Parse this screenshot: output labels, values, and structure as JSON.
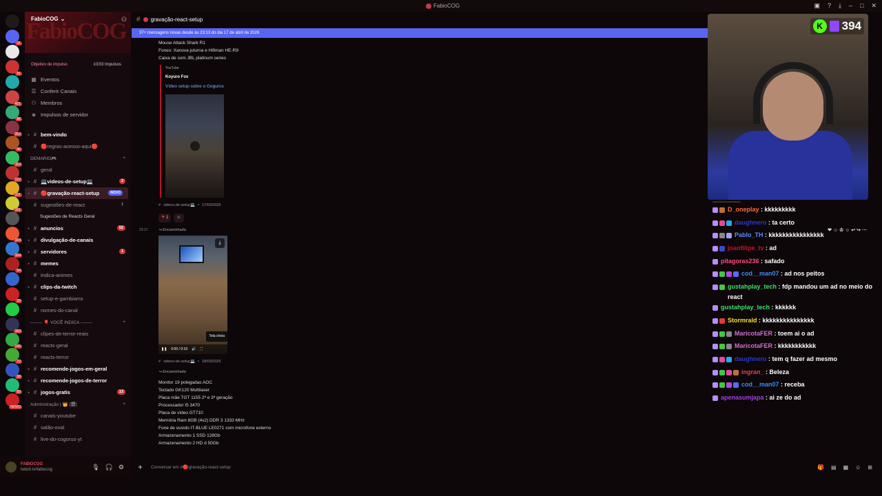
{
  "window": {
    "title": "FabioCOG"
  },
  "servers": [
    {
      "color": "#5865f2",
      "count": "31"
    },
    {
      "color": "#e8e8e8",
      "count": ""
    },
    {
      "color": "#c33",
      "count": "81"
    },
    {
      "color": "#2aa",
      "count": ""
    },
    {
      "color": "#c44",
      "count": "421"
    },
    {
      "color": "#3a7",
      "count": "86"
    },
    {
      "color": "#834",
      "count": "262"
    },
    {
      "color": "#a52",
      "count": "46"
    },
    {
      "color": "#3b6",
      "count": "110"
    },
    {
      "color": "#b33",
      "count": "122"
    },
    {
      "color": "#da2",
      "count": "101"
    },
    {
      "color": "#cc3",
      "count": "101"
    },
    {
      "color": "#555",
      "count": ""
    },
    {
      "color": "#e53",
      "count": "104"
    },
    {
      "color": "#37c",
      "count": "104"
    },
    {
      "color": "#a22",
      "count": "54"
    },
    {
      "color": "#36c",
      "count": ""
    },
    {
      "color": "#c22",
      "count": "15"
    },
    {
      "color": "#2c4",
      "count": ""
    },
    {
      "color": "#335",
      "count": "163"
    },
    {
      "color": "#3a4",
      "count": "145"
    },
    {
      "color": "#4a3",
      "count": "72"
    },
    {
      "color": "#35b",
      "count": "38"
    },
    {
      "color": "#2b7",
      "count": "83"
    },
    {
      "color": "#c22",
      "count": "NOVO"
    }
  ],
  "guild": {
    "name": "FabioCOG",
    "banner": "FabioCOG",
    "boost_label": "Objetivo de impulso",
    "boost_value": "10/33 Impulsos"
  },
  "nav": [
    {
      "label": "Eventos"
    },
    {
      "label": "Conferir Canais"
    },
    {
      "label": "Membros"
    },
    {
      "label": "Impulsos de servidor"
    }
  ],
  "channels": {
    "welcome": [
      {
        "label": "bem-vindo",
        "bold": true
      },
      {
        "label": "🔴regras-acesso-aqui🔴",
        "bold": false
      }
    ],
    "cat_demario": "DEMARIO🎮",
    "demario": [
      {
        "label": "geral",
        "bold": false,
        "badge": ""
      },
      {
        "label": "💻videos-de-setup💻",
        "bold": true,
        "badge": "2"
      },
      {
        "label": "🔴gravação-react-setup",
        "bold": true,
        "badge": "NOVO",
        "active": true
      },
      {
        "label": "sugestões-de-react",
        "bold": false,
        "badge": "1",
        "plain": true
      }
    ],
    "thread": "Sugestões de Reacts Geral",
    "demario2": [
      {
        "label": "anuncios",
        "bold": true,
        "badge": "52"
      },
      {
        "label": "divulgação-de-canais",
        "bold": true,
        "badge": ""
      },
      {
        "label": "servidores",
        "bold": true,
        "badge": "1"
      },
      {
        "label": "memes",
        "bold": true,
        "badge": ""
      },
      {
        "label": "indica-animes",
        "bold": false,
        "badge": ""
      },
      {
        "label": "clips-da-twitch",
        "bold": true,
        "badge": ""
      },
      {
        "label": "setup-e-gambiarra",
        "bold": false,
        "badge": ""
      },
      {
        "label": "nomes-do-canal",
        "bold": false,
        "badge": ""
      }
    ],
    "cat_indica": "-------- 🎈 VOCÊ INDICA --------",
    "indica": [
      {
        "label": "clipes-de-terror-reais",
        "bold": false,
        "badge": ""
      },
      {
        "label": "reacts-geral",
        "bold": false,
        "badge": ""
      },
      {
        "label": "reacts-terror",
        "bold": false,
        "badge": ""
      },
      {
        "label": "recomende-jogos-em-geral",
        "bold": true,
        "badge": ""
      },
      {
        "label": "recomende-jogos-de-terror",
        "bold": true,
        "badge": ""
      },
      {
        "label": "jogos-gratis",
        "bold": true,
        "badge": "13"
      }
    ],
    "cat_admin": "Administração | 👑 |🎬|",
    "admin": [
      {
        "label": "canais-youtube",
        "bold": false,
        "badge": ""
      },
      {
        "label": "salão-oval",
        "bold": false,
        "badge": ""
      },
      {
        "label": "live-do-cogorus-yt",
        "bold": false,
        "badge": ""
      }
    ]
  },
  "user": {
    "name": "FABIOCOG",
    "status": "twitch.tv/fabiocog"
  },
  "channel_header": {
    "name": "gravação-react-setup"
  },
  "new_messages": "37+ mensagens novas desde às 23:13 do dia 17 de abril de 2026",
  "msg1": {
    "lines": [
      "Mouse Attack Shark R1",
      "Fones: Xanova juturna e Hifiman HE-R9",
      "Caixa de som JBL platinum series"
    ],
    "provider": "YouTube",
    "author": "Koyuro Fox",
    "title": "Vídeo setup sobre o Goguros",
    "source": "videos-de-setup💻",
    "date": "17/03/2026",
    "react_count": "1"
  },
  "msg2": {
    "time": "23:17",
    "forwarded": "Encaminhada",
    "video_time": "0:00 / 0:19",
    "tooltip": "Tela cheia",
    "source": "videos-de-setup💻",
    "date": "18/03/2026"
  },
  "msg3": {
    "forwarded": "Encaminhada",
    "lines": [
      "Monitor 19 polegadas AOC",
      "Teclado GK120 Multilaser",
      "Placa mãe TGT 1155 2ª e 3ª geração",
      "Processador I5 3470",
      "Placa de vídeo GT710",
      "Memória Ram 8GB (4x2) DDR 3 1333 MHz",
      "Fone de ouvido IT-BLUE LE0271 com microfone externo",
      "Armazenamento 1 SSD 128Gb",
      "Armazenamento 2 HD d 50Gb"
    ]
  },
  "composer": {
    "placeholder": "Conversar em #🔴gravação-react-setup"
  },
  "stream": {
    "followers": "394",
    "kick_icon": "kick-logo"
  },
  "chat": {
    "separator": "------------------------------",
    "lines": [
      {
        "user": "D_oneplay",
        "color": "#ff6a3c",
        "text": ": kkkkkkkkk",
        "badges": [
          "#b98cff",
          "#c07030"
        ]
      },
      {
        "user": "daughnero",
        "color": "#2b39c8",
        "text": ": ta certo",
        "badges": [
          "#b98cff",
          "#e04a9a",
          "#2aa9f0"
        ]
      },
      {
        "user": "Pablo_TH",
        "color": "#5b8bff",
        "text": ": kkkkkkkkkkkkkkkk",
        "badges": [
          "#b98cff",
          "#888",
          "#a0a0ff"
        ]
      },
      {
        "user": "joaofilipe_tv",
        "color": "#c8102e",
        "text": ": ad",
        "badges": [
          "#b98cff",
          "#3a4ad0"
        ]
      },
      {
        "user": "pitagoras236",
        "color": "#ff4a80",
        "text": ": safado",
        "badges": [
          "#b98cff"
        ]
      },
      {
        "user": "cod__man07",
        "color": "#3c8cff",
        "text": ": ad nos peitos",
        "badges": [
          "#b98cff",
          "#41c840",
          "#b04ae0",
          "#5a68ff"
        ]
      },
      {
        "user": "gustahplay_tech",
        "color": "#3ce06a",
        "text": ": fdp mandou um ad no meio do react",
        "badges": [
          "#b98cff",
          "#41c840"
        ]
      },
      {
        "user": "gustahplay_tech",
        "color": "#3ce06a",
        "text": ": kkkkkk",
        "badges": [
          "#b98cff"
        ]
      },
      {
        "user": "Stormrald",
        "color": "#f0e030",
        "text": ": kkkkkkkkkkkkkkk",
        "badges": [
          "#b98cff",
          "#e03a3a"
        ]
      },
      {
        "user": "MaricotaFER",
        "color": "#d070d0",
        "text": ": toem ai o ad",
        "badges": [
          "#b98cff",
          "#41c840",
          "#888"
        ]
      },
      {
        "user": "MaricotaFER",
        "color": "#d070d0",
        "text": ": kkkkkkkkkkk",
        "badges": [
          "#b98cff",
          "#41c840",
          "#888"
        ]
      },
      {
        "user": "daughnero",
        "color": "#2b39c8",
        "text": ": tem q fazer ad mesmo",
        "badges": [
          "#b98cff",
          "#e04a9a",
          "#2aa9f0"
        ]
      },
      {
        "user": "ingran_",
        "color": "#e04060",
        "text": ": Beleza",
        "badges": [
          "#b98cff",
          "#41c840",
          "#e04a9a",
          "#c07030"
        ]
      },
      {
        "user": "cod__man07",
        "color": "#3c8cff",
        "text": ": receba",
        "badges": [
          "#b98cff",
          "#41c840",
          "#b04ae0",
          "#5a68ff"
        ]
      },
      {
        "user": "apenasumjapa",
        "color": "#a040e0",
        "text": ": ai ze do ad",
        "badges": [
          "#b98cff"
        ]
      }
    ]
  }
}
